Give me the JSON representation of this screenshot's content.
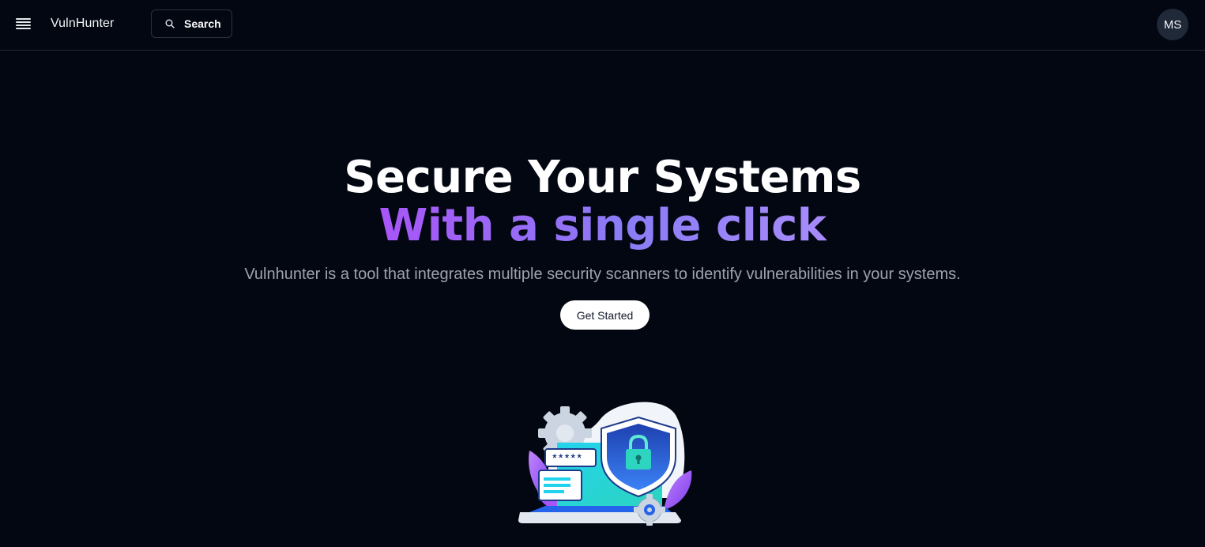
{
  "header": {
    "brand": "VulnHunter",
    "search_label": "Search",
    "avatar_initials": "MS"
  },
  "hero": {
    "title": "Secure Your Systems",
    "subtitle": "With a single click",
    "description": "Vulnhunter is a tool that integrates multiple security scanners to identify vulnerabilities in your systems.",
    "cta_label": "Get Started"
  },
  "illustration": {
    "password_mask": "*****"
  },
  "colors": {
    "background": "#030712",
    "accent_start": "#a855f7",
    "accent_end": "#a78bfa",
    "muted_text": "#9ca3af"
  },
  "icons": [
    "menu-icon",
    "search-icon",
    "shield-lock-icon",
    "gear-icon"
  ]
}
